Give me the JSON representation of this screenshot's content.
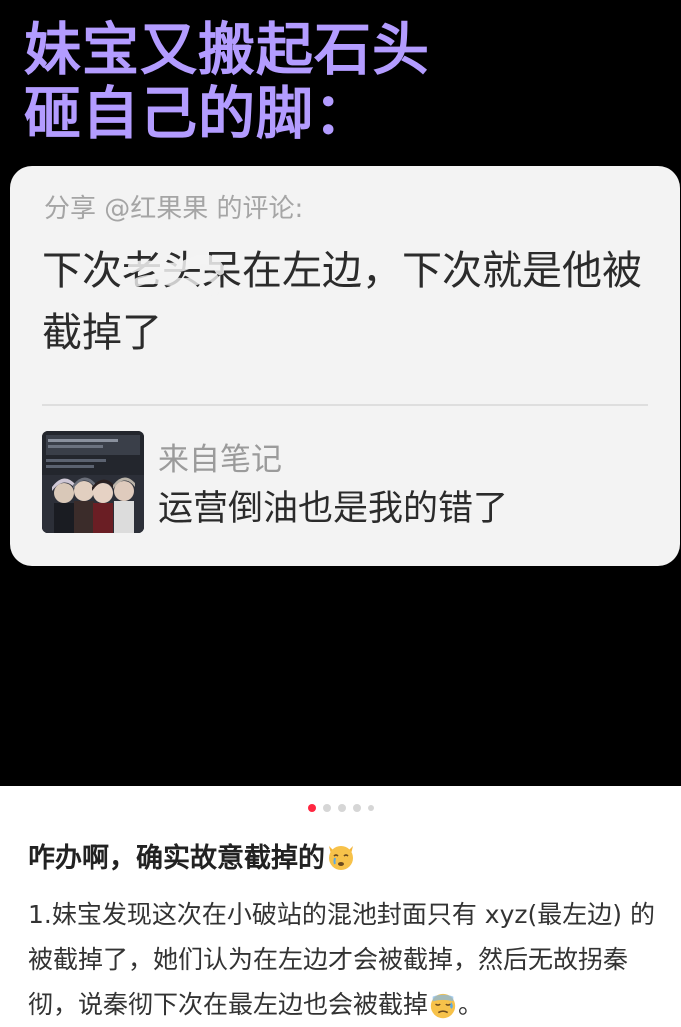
{
  "slide": {
    "headline_line1": "妹宝又搬起石头",
    "headline_line2": "砸自己的脚：",
    "card": {
      "share_label": "分享 @红果果 的评论:",
      "comment_text": "下次老头呆在左边，下次就是他被截掉了",
      "note_from": "来自笔记",
      "note_title": "运营倒油也是我的错了"
    }
  },
  "carousel": {
    "total": 5,
    "active_index": 0
  },
  "post": {
    "title": "咋办啊，确实故意截掉的",
    "title_emoji": "crying-cat-icon",
    "body": "1.妹宝发现这次在小破站的混池封面只有 xyz(最左边) 的被截掉了，她们认为在左边才会被截掉，然后无故拐秦彻，说秦彻下次在最左边也会被截掉",
    "body_emoji": "downcast-sweat-icon",
    "body_end": "。"
  },
  "colors": {
    "headline": "#b39cff",
    "card_bg": "#f3f3f3",
    "active_dot": "#ff2741"
  }
}
